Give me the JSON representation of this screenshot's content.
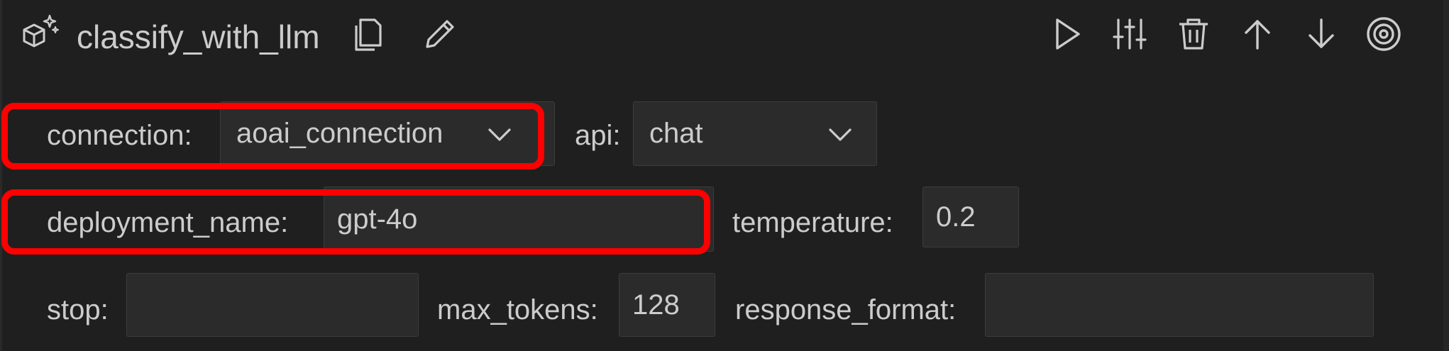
{
  "node": {
    "title": "classify_with_llm",
    "icon": "llm-sparkle-cube-icon"
  },
  "toolbar": {
    "icons": [
      "copy-icon",
      "edit-pencil-icon",
      "run-play-icon",
      "settings-sliders-icon",
      "delete-trash-icon",
      "move-up-arrow-icon",
      "move-down-arrow-icon",
      "target-icon"
    ]
  },
  "fields": {
    "connection": {
      "label": "connection:",
      "value": "aoai_connection"
    },
    "api": {
      "label": "api:",
      "value": "chat"
    },
    "deployment_name": {
      "label": "deployment_name:",
      "value": "gpt-4o"
    },
    "temperature": {
      "label": "temperature:",
      "value": "0.2"
    },
    "stop": {
      "label": "stop:",
      "value": ""
    },
    "max_tokens": {
      "label": "max_tokens:",
      "value": "128"
    },
    "response_format": {
      "label": "response_format:",
      "value": ""
    }
  },
  "colors": {
    "background": "#1f1f1f",
    "field_background": "#2b2b2b",
    "text": "#cccccc",
    "highlight": "#ff0000"
  }
}
